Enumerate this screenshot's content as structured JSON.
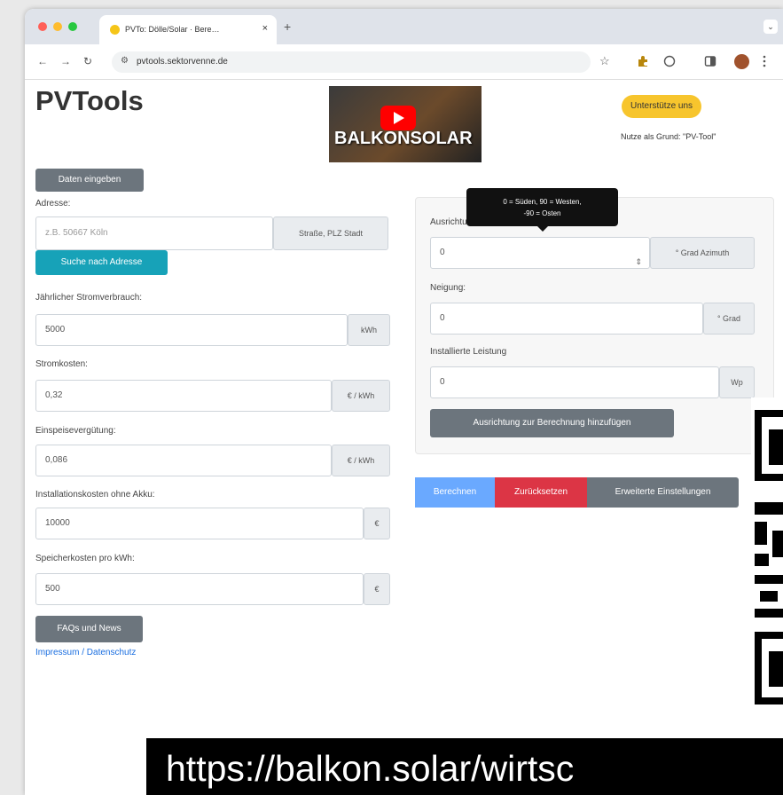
{
  "browser": {
    "tab_title": "PVTo: Dölle/Solar · Bere…",
    "tab_close": "×",
    "new_tab": "+",
    "tab_menu": "⌄",
    "back": "←",
    "forward": "→",
    "reload": "↻",
    "site_settings": "⚙",
    "url": "pvtools.sektorvenne.de",
    "bookmark_star": "☆"
  },
  "header": {
    "logo": "PVTools",
    "video_text": "BALKONSOLAR",
    "support_button": "Unterstütze uns",
    "nutze_text": "Nutze als Grund: \"PV-Tool\""
  },
  "form": {
    "data_button": "Daten eingeben",
    "address_label": "Adresse:",
    "address_placeholder": "z.B. 50667 Köln",
    "address_addon": "Straße, PLZ Stadt",
    "search_button": "Suche nach Adresse",
    "consumption_label": "Jährlicher Stromverbrauch:",
    "consumption_value": "5000",
    "consumption_unit": "kWh",
    "cost_label": "Stromkosten:",
    "cost_value": "0,32",
    "cost_unit": "€ / kWh",
    "feedin_label": "Einspeisevergütung:",
    "feedin_value": "0,086",
    "feedin_unit": "€ / kWh",
    "install_label": "Installationskosten ohne Akku:",
    "install_value": "10000",
    "install_unit": "€",
    "storage_label": "Speicherkosten pro kWh:",
    "storage_value": "500",
    "storage_unit": "€",
    "faq_button": "FAQs und News",
    "imprint_link": "Impressum / Datenschutz"
  },
  "orientation": {
    "tooltip_line1": "0 = Süden, 90 = Westen,",
    "tooltip_line2": "-90 = Osten",
    "azimuth_label": "Ausrichtung:",
    "azimuth_value": "0",
    "azimuth_spinner": "⇕",
    "azimuth_unit": "° Grad Azimuth",
    "tilt_label": "Neigung:",
    "tilt_value": "0",
    "tilt_unit": "° Grad",
    "power_label": "Installierte Leistung",
    "power_value": "0",
    "power_unit": "Wp",
    "add_button": "Ausrichtung zur Berechnung hinzufügen"
  },
  "actions": {
    "calculate": "Berechnen",
    "reset": "Zurücksetzen",
    "advanced": "Erweiterte Einstellungen"
  },
  "overlay": {
    "url_text": "https://balkon.solar/wirtsc"
  },
  "colors": {
    "primary_gray": "#6c757d",
    "teal": "#17a2b8",
    "red": "#dc3545",
    "blue": "#6aa9ff",
    "yellow": "#f7c52d"
  }
}
